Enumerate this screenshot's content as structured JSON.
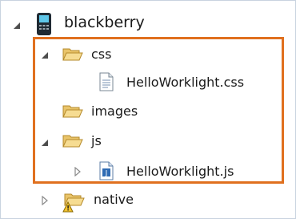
{
  "tree": {
    "root": {
      "label": "blackberry",
      "icon": "blackberry-device-icon",
      "expanded": true
    },
    "items": [
      {
        "label": "css",
        "icon": "folder-open-icon",
        "expanded": true
      },
      {
        "label": "HelloWorklight.css",
        "icon": "css-file-icon"
      },
      {
        "label": "images",
        "icon": "folder-open-icon",
        "expanded": false
      },
      {
        "label": "js",
        "icon": "folder-open-icon",
        "expanded": true
      },
      {
        "label": "HelloWorklight.js",
        "icon": "js-file-icon"
      },
      {
        "label": "native",
        "icon": "folder-warning-icon",
        "expanded": false
      }
    ]
  },
  "colors": {
    "highlight": "#e0701f",
    "folder": "#e8c36a",
    "folder_stroke": "#b58a2a",
    "twisty": "#555555"
  }
}
